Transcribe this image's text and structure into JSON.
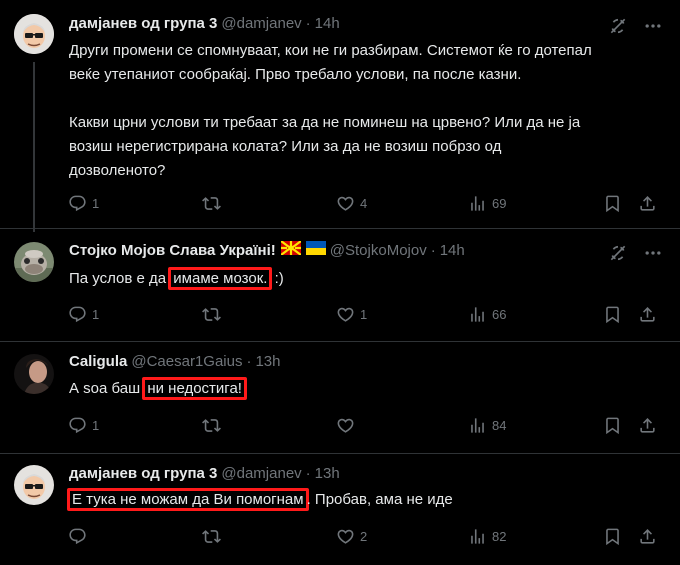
{
  "colors": {
    "background": "#000000",
    "text": "#e7e9ea",
    "secondary": "#71767b",
    "border": "#2f3336",
    "highlight": "#ff1a1a"
  },
  "tweets": [
    {
      "name": "дамјанев од група 3",
      "handle": "@damjanev",
      "sep": "·",
      "time": "14h",
      "lines_p1": [
        "Други промени се спомнуваат, кои не ги разбирам. Системот ќе го дотепал",
        "веќе утепаниот сообраќај. Прво требало услови, па после казни."
      ],
      "lines_p2": [
        "Какви црни услови ти требаат за да не поминеш на црвено? Или да не ја",
        "возиш нерегистрирана колата? Или за да не возиш побрзо од",
        "дозволеното?"
      ],
      "replies": "1",
      "reposts": "",
      "likes": "4",
      "views": "69"
    },
    {
      "name": "Стојко Мојов Слава Україні!",
      "flags": [
        "mk-flag-icon",
        "ua-flag-icon"
      ],
      "handle": "@StojkoMojov",
      "sep": "·",
      "time": "14h",
      "text_before": "Па услов е да ",
      "text_highlight": "имаме мозок.",
      "text_after": " :)",
      "replies": "1",
      "reposts": "",
      "likes": "1",
      "views": "66"
    },
    {
      "name": "Caligula",
      "handle": "@Caesar1Gaius",
      "sep": "·",
      "time": "13h",
      "text_before": "А soa баш ",
      "text_highlight": "ни недостига!",
      "text_after": "",
      "replies": "1",
      "reposts": "",
      "likes": "",
      "views": "84"
    },
    {
      "name": "дамјанев од група 3",
      "handle": "@damjanev",
      "sep": "·",
      "time": "13h",
      "text_before": "",
      "text_highlight": "Е тука не можам да Ви помогнам",
      "text_after": ". Пробав, ама не иде",
      "replies": "",
      "reposts": "",
      "likes": "2",
      "views": "82"
    }
  ]
}
